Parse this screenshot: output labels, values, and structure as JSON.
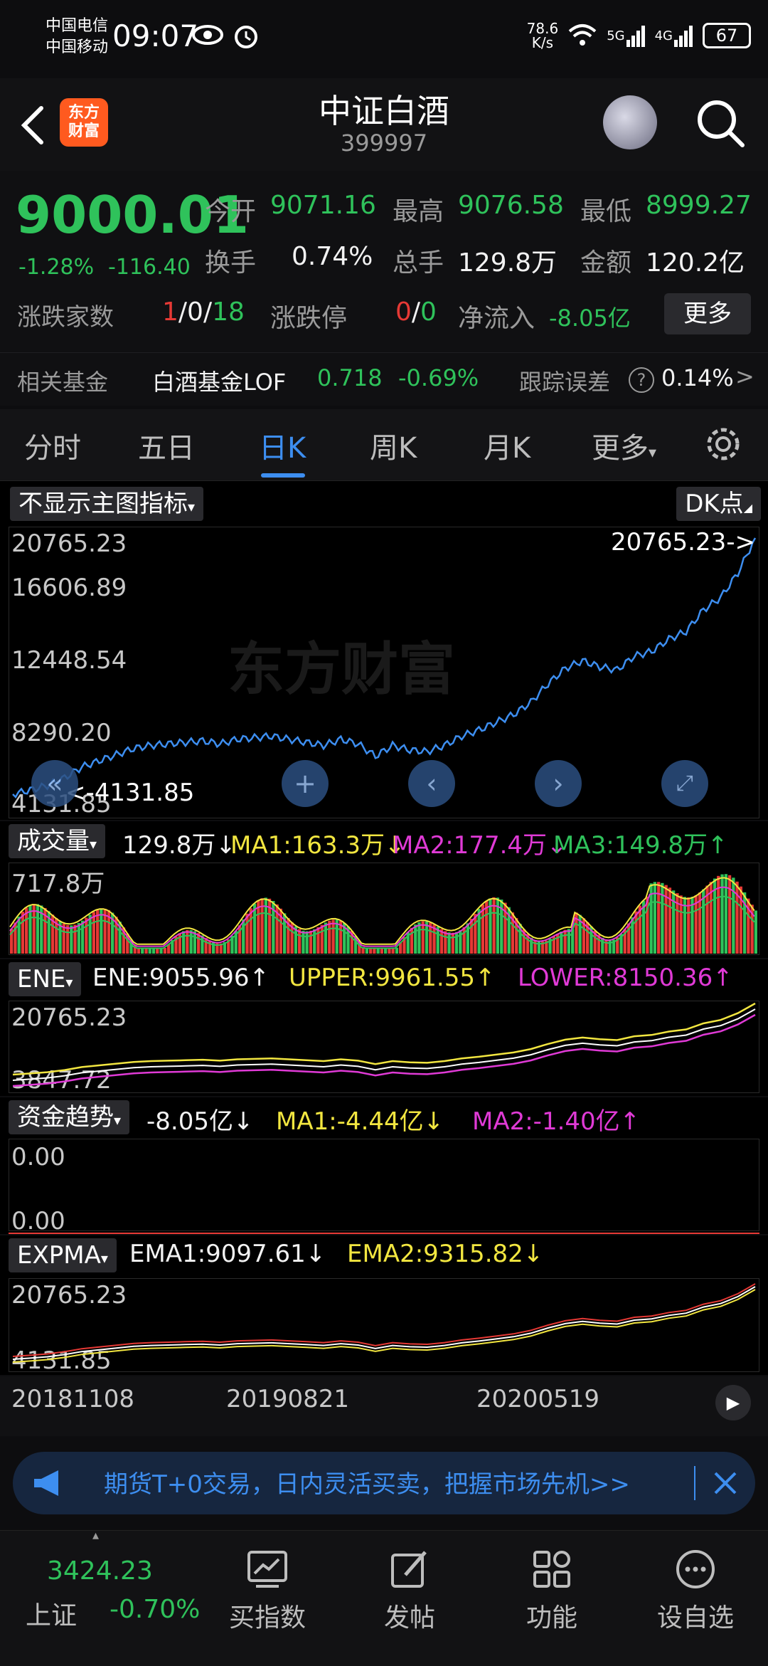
{
  "status_bar": {
    "carrier1": "中国电信",
    "carrier2": "中国移动",
    "time": "09:07",
    "net_speed": "78.6\nK/s",
    "net_speed_top": "78.6",
    "net_speed_bottom": "K/s",
    "signal1": "5G",
    "signal2": "4G",
    "battery": "67"
  },
  "header": {
    "logo_text_top": "东方",
    "logo_text_bottom": "财富",
    "title": "中证白酒",
    "code": "399997"
  },
  "quote": {
    "price": "9000.01",
    "pct_change": "-1.28%",
    "change": "-116.40",
    "open_label": "今开",
    "open": "9071.16",
    "high_label": "最高",
    "high": "9076.58",
    "low_label": "最低",
    "low": "8999.27",
    "turnover_label": "换手",
    "turnover": "0.74%",
    "volume_label": "总手",
    "volume": "129.8万",
    "amount_label": "金额",
    "amount": "120.2亿",
    "breadth_label": "涨跌家数",
    "breadth_up": "1",
    "breadth_flat": "0",
    "breadth_down": "18",
    "slash": "/",
    "limit_label": "涨跌停",
    "limit_up": "0",
    "limit_down": "0",
    "netflow_label": "净流入",
    "netflow": "-8.05亿",
    "more": "更多"
  },
  "fund": {
    "label": "相关基金",
    "name": "白酒基金LOF",
    "price": "0.718",
    "pct": "-0.69%",
    "tracking_label": "跟踪误差",
    "tracking_value": "0.14%",
    "help": "?",
    "arrow": ">"
  },
  "tabs": [
    {
      "label": "分时"
    },
    {
      "label": "五日"
    },
    {
      "label": "日K"
    },
    {
      "label": "周K"
    },
    {
      "label": "月K"
    },
    {
      "label": "更多"
    }
  ],
  "main_chart": {
    "indicator_btn": "不显示主图指标",
    "dk_btn": "DK点",
    "y_labels": [
      "20765.23",
      "16606.89",
      "12448.54",
      "8290.20",
      "4131.85"
    ],
    "max_marker": "20765.23->",
    "min_marker": "<-4131.85",
    "watermark": "东方财富"
  },
  "volume_panel": {
    "btn": "成交量",
    "value": "129.8万↓",
    "ma1": "MA1:163.3万↓",
    "ma2": "MA2:177.4万↓",
    "ma3": "MA3:149.8万↑",
    "ylabel": "717.8万"
  },
  "ene_panel": {
    "btn": "ENE",
    "ene": "ENE:9055.96↑",
    "upper": "UPPER:9961.55↑",
    "lower": "LOWER:8150.36↑",
    "ytop": "20765.23",
    "ybottom": "3847.72"
  },
  "fund_trend_panel": {
    "btn": "资金趋势",
    "value": "-8.05亿↓",
    "ma1": "MA1:-4.44亿↓",
    "ma2": "MA2:-1.40亿↑",
    "ytop": "0.00",
    "ybottom": "0.00"
  },
  "expma_panel": {
    "btn": "EXPMA",
    "ema1": "EMA1:9097.61↓",
    "ema2": "EMA2:9315.82↓",
    "ytop": "20765.23",
    "ybottom": "4131.85"
  },
  "x_axis": [
    "20181108",
    "20190821",
    "20200519"
  ],
  "banner": {
    "text": "期货T+0交易，日内灵活买卖，把握市场先机>>"
  },
  "bottom_nav": {
    "index_value": "3424.23",
    "index_name": "上证",
    "index_pct": "-0.70%",
    "items": [
      {
        "label": "买指数"
      },
      {
        "label": "发帖"
      },
      {
        "label": "功能"
      },
      {
        "label": "设自选"
      }
    ]
  },
  "colors": {
    "up": "#e53935",
    "down": "#2fc25b",
    "accent": "#3d8ef0",
    "ma1": "#f2e640",
    "ma2": "#e03ad6",
    "ma3": "#2fc25b"
  },
  "chart_data": {
    "type": "line",
    "y_range": [
      4131.85,
      20765.23
    ],
    "x_ticks": [
      "20181108",
      "20190821",
      "20200519"
    ],
    "series": [
      {
        "values": [
          4131.85,
          4400,
          4700,
          5200,
          5900,
          6300,
          6700,
          7100,
          7300,
          7400,
          7500,
          7600,
          7400,
          7700,
          7800,
          7900,
          7700,
          7500,
          7300,
          7700,
          7400,
          6600,
          7300,
          7000,
          6900,
          7300,
          7900,
          8300,
          8800,
          9300,
          10100,
          11300,
          12300,
          12800,
          12400,
          12200,
          13100,
          13400,
          14200,
          14700,
          16100,
          16900,
          18500,
          20765.23
        ]
      }
    ]
  }
}
